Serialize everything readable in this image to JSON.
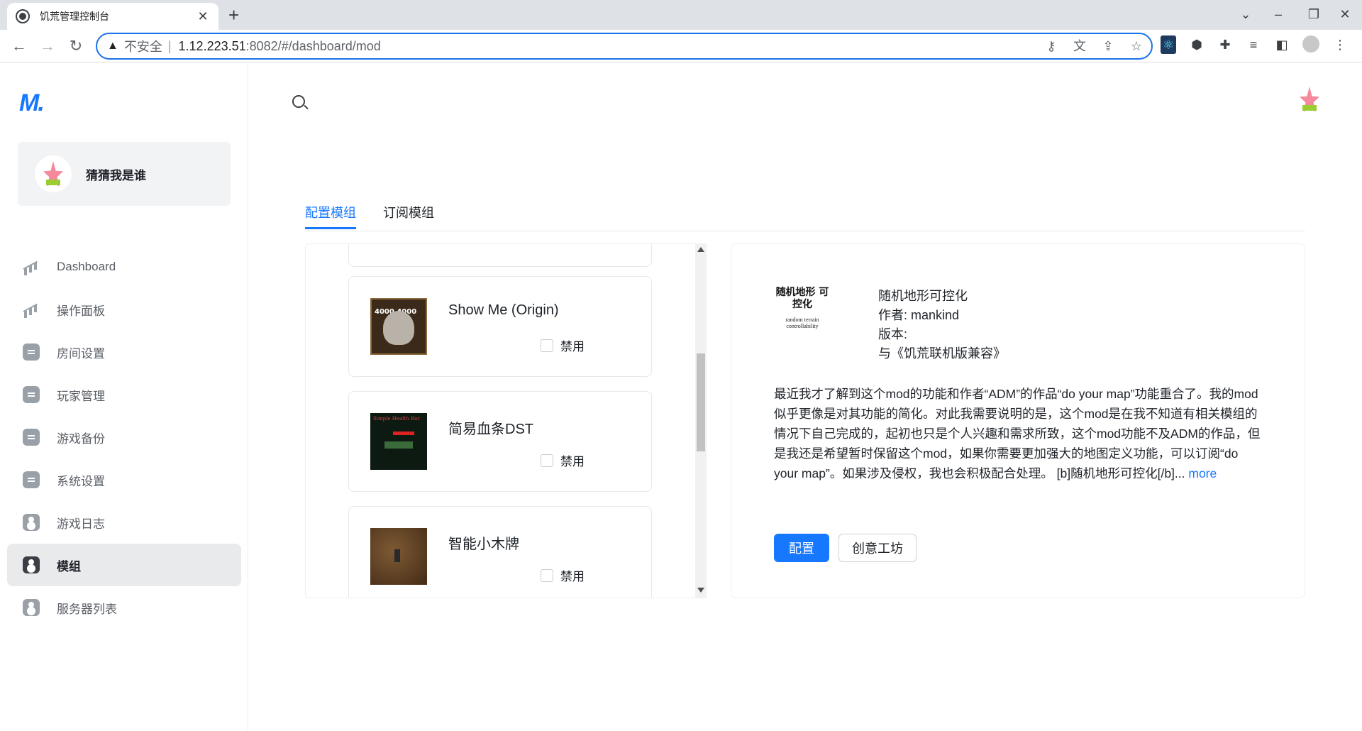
{
  "browser": {
    "tab_title": "饥荒管理控制台",
    "insecure_label": "不安全",
    "url_host": "1.12.223.51",
    "url_rest": ":8082/#/dashboard/mod"
  },
  "sidebar": {
    "user_name": "猜猜我是谁",
    "items": [
      {
        "label": "Dashboard",
        "icon": "chart-icon"
      },
      {
        "label": "操作面板",
        "icon": "chart-icon"
      },
      {
        "label": "房间设置",
        "icon": "doc-icon"
      },
      {
        "label": "玩家管理",
        "icon": "doc-icon"
      },
      {
        "label": "游戏备份",
        "icon": "doc-icon"
      },
      {
        "label": "系统设置",
        "icon": "doc-icon"
      },
      {
        "label": "游戏日志",
        "icon": "person-icon"
      },
      {
        "label": "模组",
        "icon": "person-icon"
      },
      {
        "label": "服务器列表",
        "icon": "person-icon"
      }
    ]
  },
  "tabs": [
    {
      "label": "配置模组"
    },
    {
      "label": "订阅模组"
    }
  ],
  "mods": [
    {
      "name": "Show Me (Origin)",
      "disable_label": "禁用",
      "thumb_text": "4000 4000"
    },
    {
      "name": "简易血条DST",
      "disable_label": "禁用",
      "thumb_text": "Simple Health Bar"
    },
    {
      "name": "智能小木牌",
      "disable_label": "禁用"
    }
  ],
  "detail": {
    "thumb_cn": "随机地形 可控化",
    "thumb_en": "random terrain controllability",
    "title": "随机地形可控化",
    "author": "作者: mankind",
    "version": "版本:",
    "compat": "与《饥荒联机版兼容》",
    "description": "最近我才了解到这个mod的功能和作者“ADM”的作品“do your map”功能重合了。我的mod似乎更像是对其功能的简化。对此我需要说明的是，这个mod是在我不知道有相关模组的情况下自己完成的，起初也只是个人兴趣和需求所致，这个mod功能不及ADM的作品，但是我还是希望暂时保留这个mod，如果你需要更加强大的地图定义功能，可以订阅“do your map”。如果涉及侵权，我也会积极配合处理。 [b]随机地形可控化[/b]...",
    "more_label": "more",
    "config_button": "配置",
    "workshop_button": "创意工坊"
  }
}
